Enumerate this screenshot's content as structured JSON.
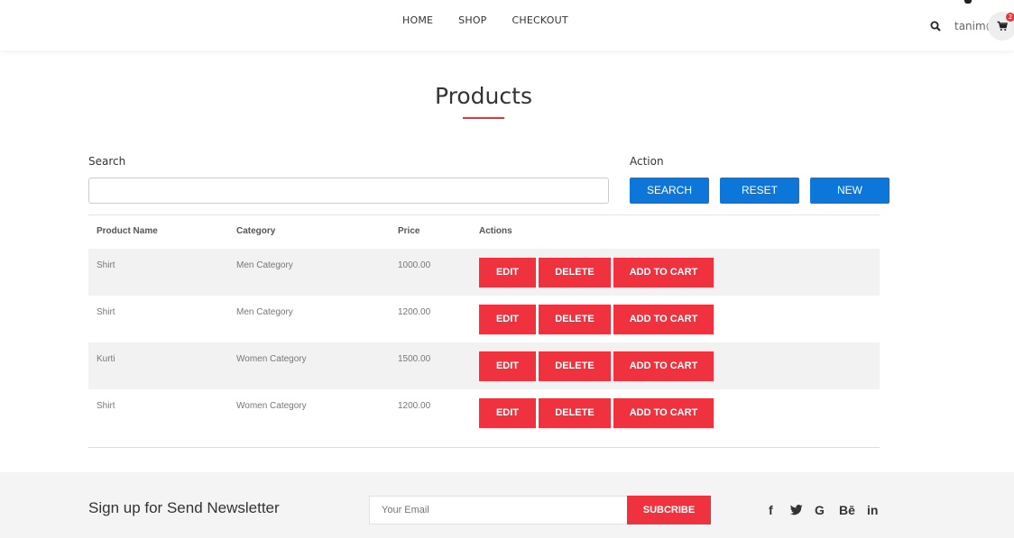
{
  "nav": {
    "items": [
      "HOME",
      "SHOP",
      "CHECKOUT"
    ]
  },
  "header": {
    "user_text": "tanim@",
    "cart_count": "2",
    "icons": [
      "search-icon",
      "cart-icon"
    ]
  },
  "page": {
    "title": "Products"
  },
  "search": {
    "label": "Search",
    "value": "",
    "placeholder": ""
  },
  "actions": {
    "label": "Action",
    "buttons": [
      "SEARCH",
      "RESET",
      "NEW"
    ]
  },
  "table": {
    "headers": [
      "Product Name",
      "Category",
      "Price",
      "Actions"
    ],
    "rows": [
      {
        "name": "Shirt",
        "category": "Men Category",
        "price": "1000.00"
      },
      {
        "name": "Shirt",
        "category": "Men Category",
        "price": "1200.00"
      },
      {
        "name": "Kurti",
        "category": "Women Category",
        "price": "1500.00"
      },
      {
        "name": "Shirt",
        "category": "Women Category",
        "price": "1200.00"
      }
    ],
    "row_actions": {
      "edit": "EDIT",
      "delete": "DELETE",
      "add_to_cart": "ADD TO CART"
    }
  },
  "footer": {
    "newsletter_title": "Sign up for Send Newsletter",
    "email_placeholder": "Your Email",
    "subscribe_label": "SUBCRIBE",
    "social": [
      "f",
      "t",
      "G",
      "Bē",
      "in"
    ],
    "social_icons": [
      "facebook-icon",
      "twitter-icon",
      "google-icon",
      "behance-icon",
      "linkedin-icon"
    ]
  },
  "colors": {
    "accent_red": "#f0323e",
    "primary_blue": "#0d76db"
  }
}
